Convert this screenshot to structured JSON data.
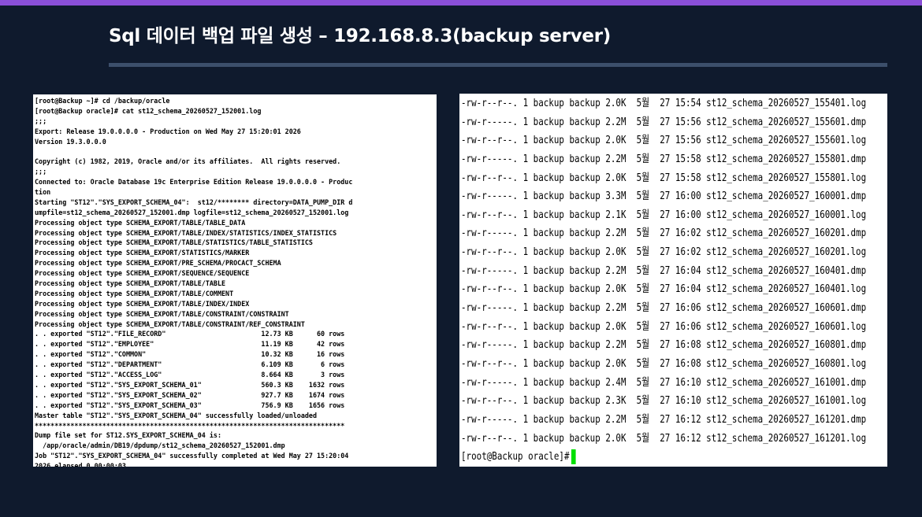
{
  "title": "Sql 데이터 백업 파일 생성 – 192.168.8.3(backup server)",
  "colors": {
    "background": "#0f1a2d",
    "accent_bar": "#8a4fd8",
    "divider": "#3c4f6b",
    "cursor": "#00e000"
  },
  "left_terminal": {
    "lines": [
      "[root@Backup ~]# cd /backup/oracle",
      "[root@Backup oracle]# cat st12_schema_20260527_152001.log",
      ";;;",
      "Export: Release 19.0.0.0.0 - Production on Wed May 27 15:20:01 2026",
      "Version 19.3.0.0.0",
      "",
      "Copyright (c) 1982, 2019, Oracle and/or its affiliates.  All rights reserved.",
      ";;;",
      "Connected to: Oracle Database 19c Enterprise Edition Release 19.0.0.0.0 - Produc",
      "tion",
      "Starting \"ST12\".\"SYS_EXPORT_SCHEMA_04\":  st12/******** directory=DATA_PUMP_DIR d",
      "umpfile=st12_schema_20260527_152001.dmp logfile=st12_schema_20260527_152001.log",
      "Processing object type SCHEMA_EXPORT/TABLE/TABLE_DATA",
      "Processing object type SCHEMA_EXPORT/TABLE/INDEX/STATISTICS/INDEX_STATISTICS",
      "Processing object type SCHEMA_EXPORT/TABLE/STATISTICS/TABLE_STATISTICS",
      "Processing object type SCHEMA_EXPORT/STATISTICS/MARKER",
      "Processing object type SCHEMA_EXPORT/PRE_SCHEMA/PROCACT_SCHEMA",
      "Processing object type SCHEMA_EXPORT/SEQUENCE/SEQUENCE",
      "Processing object type SCHEMA_EXPORT/TABLE/TABLE",
      "Processing object type SCHEMA_EXPORT/TABLE/COMMENT",
      "Processing object type SCHEMA_EXPORT/TABLE/INDEX/INDEX",
      "Processing object type SCHEMA_EXPORT/TABLE/CONSTRAINT/CONSTRAINT",
      "Processing object type SCHEMA_EXPORT/TABLE/CONSTRAINT/REF_CONSTRAINT",
      ". . exported \"ST12\".\"FILE_RECORD\"                        12.73 KB      60 rows",
      ". . exported \"ST12\".\"EMPLOYEE\"                           11.19 KB      42 rows",
      ". . exported \"ST12\".\"COMMON\"                             10.32 KB      16 rows",
      ". . exported \"ST12\".\"DEPARTMENT\"                         6.109 KB       6 rows",
      ". . exported \"ST12\".\"ACCESS_LOG\"                         8.664 KB       3 rows",
      ". . exported \"ST12\".\"SYS_EXPORT_SCHEMA_01\"               560.3 KB    1632 rows",
      ". . exported \"ST12\".\"SYS_EXPORT_SCHEMA_02\"               927.7 KB    1674 rows",
      ". . exported \"ST12\".\"SYS_EXPORT_SCHEMA_03\"               756.9 KB    1656 rows",
      "Master table \"ST12\".\"SYS_EXPORT_SCHEMA_04\" successfully loaded/unloaded",
      "******************************************************************************",
      "Dump file set for ST12.SYS_EXPORT_SCHEMA_04 is:",
      "  /app/oracle/admin/DB19/dpdump/st12_schema_20260527_152001.dmp",
      "Job \"ST12\".\"SYS_EXPORT_SCHEMA_04\" successfully completed at Wed May 27 15:20:04",
      "2026 elapsed 0 00:00:03"
    ]
  },
  "right_terminal": {
    "lines": [
      "-rw-r--r--. 1 backup backup 2.0K  5월  27 15:54 st12_schema_20260527_155401.log",
      "-rw-r-----. 1 backup backup 2.2M  5월  27 15:56 st12_schema_20260527_155601.dmp",
      "-rw-r--r--. 1 backup backup 2.0K  5월  27 15:56 st12_schema_20260527_155601.log",
      "-rw-r-----. 1 backup backup 2.2M  5월  27 15:58 st12_schema_20260527_155801.dmp",
      "-rw-r--r--. 1 backup backup 2.0K  5월  27 15:58 st12_schema_20260527_155801.log",
      "-rw-r-----. 1 backup backup 3.3M  5월  27 16:00 st12_schema_20260527_160001.dmp",
      "-rw-r--r--. 1 backup backup 2.1K  5월  27 16:00 st12_schema_20260527_160001.log",
      "-rw-r-----. 1 backup backup 2.2M  5월  27 16:02 st12_schema_20260527_160201.dmp",
      "-rw-r--r--. 1 backup backup 2.0K  5월  27 16:02 st12_schema_20260527_160201.log",
      "-rw-r-----. 1 backup backup 2.2M  5월  27 16:04 st12_schema_20260527_160401.dmp",
      "-rw-r--r--. 1 backup backup 2.0K  5월  27 16:04 st12_schema_20260527_160401.log",
      "-rw-r-----. 1 backup backup 2.2M  5월  27 16:06 st12_schema_20260527_160601.dmp",
      "-rw-r--r--. 1 backup backup 2.0K  5월  27 16:06 st12_schema_20260527_160601.log",
      "-rw-r-----. 1 backup backup 2.2M  5월  27 16:08 st12_schema_20260527_160801.dmp",
      "-rw-r--r--. 1 backup backup 2.0K  5월  27 16:08 st12_schema_20260527_160801.log",
      "-rw-r-----. 1 backup backup 2.4M  5월  27 16:10 st12_schema_20260527_161001.dmp",
      "-rw-r--r--. 1 backup backup 2.3K  5월  27 16:10 st12_schema_20260527_161001.log",
      "-rw-r-----. 1 backup backup 2.2M  5월  27 16:12 st12_schema_20260527_161201.dmp",
      "-rw-r--r--. 1 backup backup 2.0K  5월  27 16:12 st12_schema_20260527_161201.log"
    ],
    "prompt": "[root@Backup oracle]#"
  }
}
